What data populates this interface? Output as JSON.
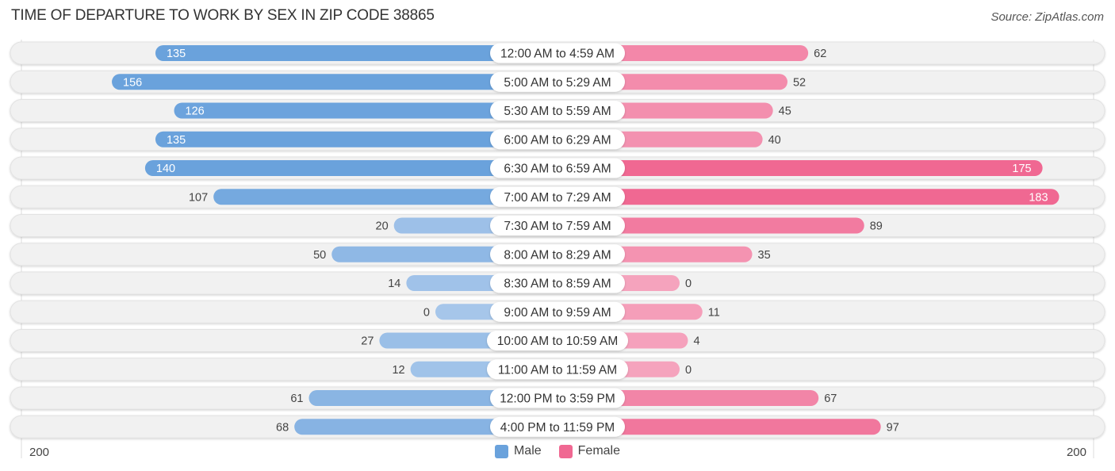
{
  "header": {
    "title": "TIME OF DEPARTURE TO WORK BY SEX IN ZIP CODE 38865",
    "source": "Source: ZipAtlas.com"
  },
  "colors": {
    "male": "#6aa2dc",
    "male_light": "#a6c6ea",
    "female": "#f06892",
    "female_light": "#f5a3bd",
    "track": "#f1f1f1",
    "pill_bg": "#ffffff"
  },
  "legend": {
    "male_label": "Male",
    "female_label": "Female"
  },
  "axis": {
    "left_label": "200",
    "right_label": "200"
  },
  "chart_data": {
    "type": "bar",
    "orientation": "horizontal-diverging",
    "title": "TIME OF DEPARTURE TO WORK BY SEX IN ZIP CODE 38865",
    "xlabel": "",
    "ylabel": "",
    "xlim": [
      -200,
      200
    ],
    "legend_position": "bottom-center",
    "grid": false,
    "categories": [
      "12:00 AM to 4:59 AM",
      "5:00 AM to 5:29 AM",
      "5:30 AM to 5:59 AM",
      "6:00 AM to 6:29 AM",
      "6:30 AM to 6:59 AM",
      "7:00 AM to 7:29 AM",
      "7:30 AM to 7:59 AM",
      "8:00 AM to 8:29 AM",
      "8:30 AM to 8:59 AM",
      "9:00 AM to 9:59 AM",
      "10:00 AM to 10:59 AM",
      "11:00 AM to 11:59 AM",
      "12:00 PM to 3:59 PM",
      "4:00 PM to 11:59 PM"
    ],
    "series": [
      {
        "name": "Male",
        "values": [
          135,
          156,
          126,
          135,
          140,
          107,
          20,
          50,
          14,
          0,
          27,
          12,
          61,
          68
        ]
      },
      {
        "name": "Female",
        "values": [
          62,
          52,
          45,
          40,
          175,
          183,
          89,
          35,
          0,
          11,
          4,
          0,
          67,
          97
        ]
      }
    ],
    "axis_tick_labels": [
      "200",
      "200"
    ]
  }
}
